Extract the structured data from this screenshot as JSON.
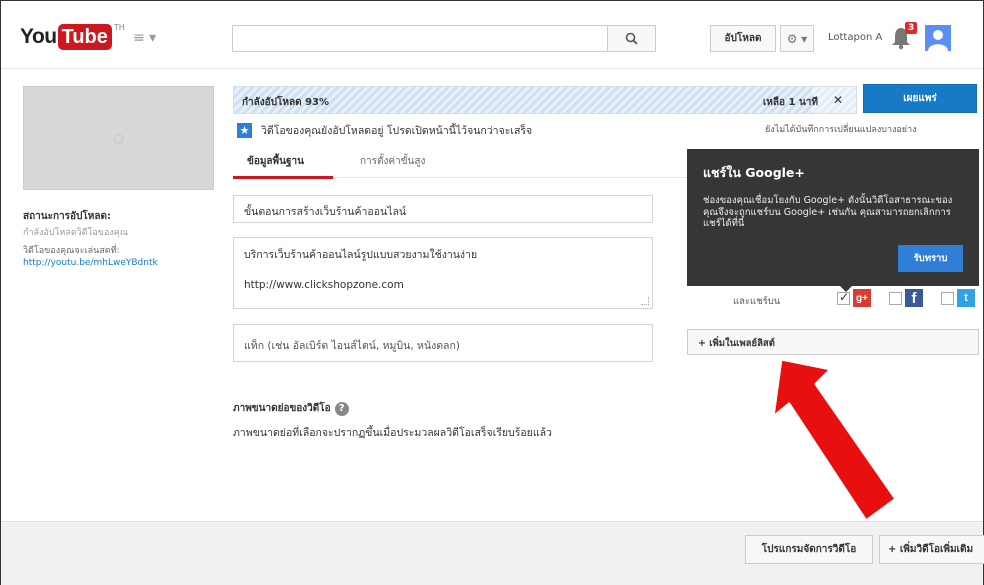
{
  "header": {
    "logo_you": "You",
    "logo_tube": "Tube",
    "logo_region": "TH",
    "guide_icon": "≡ ▾",
    "search_placeholder": "",
    "upload_label": "อัปโหลด",
    "settings_label": "⚙ ▾",
    "username": "Lottapon A",
    "notification_count": "3"
  },
  "sidebar": {
    "thumbnail_spinner": "◌",
    "status_title": "สถานะการอัปโหลด:",
    "status_sub": "กำลังอัปโหลดวิดีโอของคุณ",
    "link_prefix": "วิดีโอของคุณจะเล่นสดที่:",
    "link_url": "http://youtu.be/mhLweYBdntk"
  },
  "progress": {
    "label": "กำลังอัปโหลด 93%",
    "percent": 93,
    "remaining": "เหลือ 1 นาที",
    "close": "✕"
  },
  "publish_label": "เผยแพร่",
  "unsaved_note": "ยังไม่ได้บันทึกการเปลี่ยนแปลงบางอย่าง",
  "info_message": "วิดีโอของคุณยังอัปโหลดอยู่ โปรดเปิดหน้านี้ไว้จนกว่าจะเสร็จ",
  "star_icon": "★",
  "tabs": {
    "basic": "ข้อมูลพื้นฐาน",
    "advanced": "การตั้งค่าขั้นสูง"
  },
  "form": {
    "title": "ขั้นตอนการสร้างเว็บร้านค้าออนไลน์",
    "description_line1": "บริการเว็บร้านค้าออนไลน์รูปแบบสวยงามใช้งานง่าย",
    "description_line2": "http://www.clickshopzone.com",
    "tags_placeholder": "แท็ก (เช่น อัลเบิร์ต ไอนส์ไตน์, หมูบิน, หนังตลก)"
  },
  "thumbnail_section": {
    "title": "ภาพขนาดย่อของวิดีโอ",
    "help": "?",
    "note": "ภาพขนาดย่อที่เลือกจะปรากฏขึ้นเมื่อประมวลผลวิดีโอเสร็จเรียบร้อยแล้ว"
  },
  "share": {
    "label": "และแชร์บน",
    "gplus": "g+",
    "facebook": "f",
    "twitter": "t",
    "gplus_checked": true
  },
  "popup": {
    "title": "แชร์ใน Google+",
    "body": "ช่องของคุณเชื่อมโยงกับ Google+ ดังนั้นวิดีโอสาธารณะของคุณจึงจะถูกแชร์บน Google+ เช่นกัน คุณสามารถยกเลิกการแชร์ได้ที่นี่",
    "button": "รับทราบ"
  },
  "playlist_button": "+ เพิ่มในเพลย์ลิสต์",
  "footer": {
    "video_manager": "โปรแกรมจัดการวิดีโอ",
    "add_more": "+ เพิ่มวิดีโอเพิ่มเติม"
  },
  "colors": {
    "brand_red": "#cc181e",
    "primary_blue": "#167ac6",
    "popup_bg": "#363636",
    "arrow_red": "#e8100f"
  }
}
